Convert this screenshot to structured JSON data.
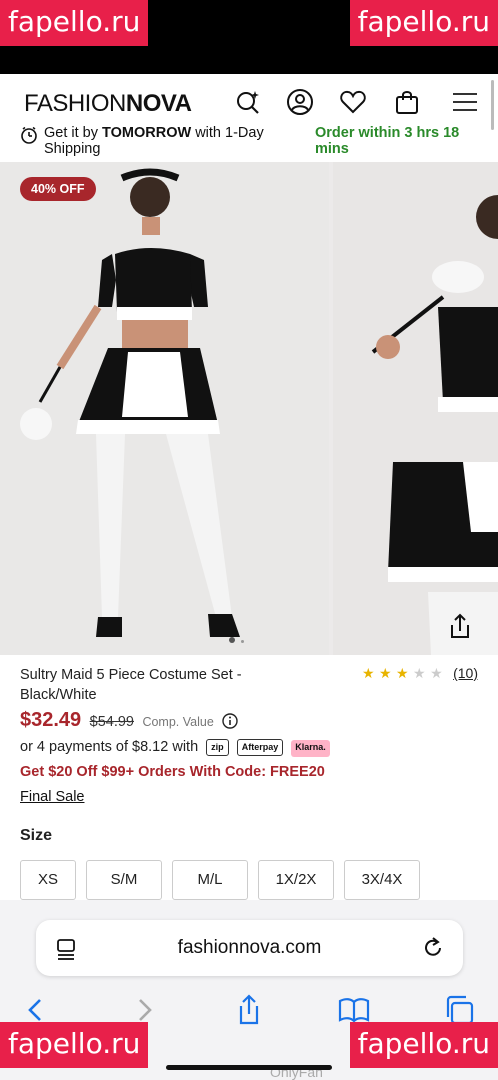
{
  "watermarks": [
    "fapello.ru",
    "fapello.ru",
    "fapello.ru",
    "fapello.ru"
  ],
  "header": {
    "logo_part1": "FASHION",
    "logo_part2": "NOVA",
    "icons": [
      "search-sparkle-icon",
      "account-icon",
      "heart-icon",
      "bag-icon",
      "menu-icon"
    ]
  },
  "delivery": {
    "prefix": "Get it by ",
    "bold": "TOMORROW",
    "suffix": " with 1-Day Shipping",
    "countdown": "Order within 3 hrs 18 mins"
  },
  "gallery": {
    "badge": "40% OFF",
    "slide_count": 3,
    "active_slide": 1
  },
  "product": {
    "title": "Sultry Maid 5 Piece Costume Set - Black/White",
    "rating": 3,
    "rating_max": 5,
    "review_count": "(10)",
    "price": "$32.49",
    "old_price": "$54.99",
    "comp_value": "Comp. Value",
    "installments": "or 4 payments of $8.12 with",
    "pay_logos": [
      "zip",
      "Afterpay",
      "Klarna."
    ],
    "promo": "Get $20 Off $99+ Orders With Code: FREE20",
    "final_sale": "Final Sale",
    "size_label": "Size",
    "sizes": [
      "XS",
      "S/M",
      "M/L",
      "1X/2X",
      "3X/4X"
    ]
  },
  "browser": {
    "url": "fashionnova.com",
    "ghost_text": "OnlyFan"
  },
  "colors": {
    "accent_red": "#a8262c",
    "green": "#2a8a2a",
    "watermark": "#e8204a"
  }
}
